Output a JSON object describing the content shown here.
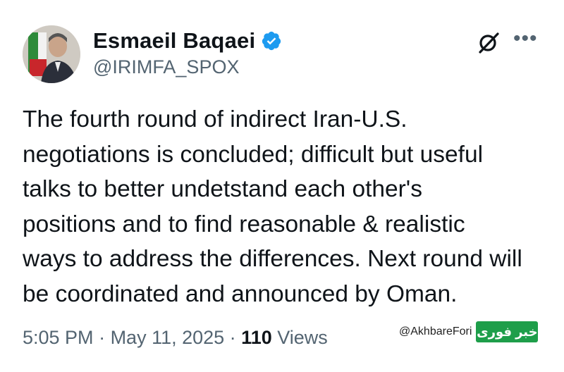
{
  "author": {
    "name": "Esmaeil Baqaei",
    "handle": "@IRIMFA_SPOX"
  },
  "post": {
    "lines": [
      "The fourth round of indirect Iran-U.S.",
      "negotiations is concluded; difficult but useful",
      "talks to better undetstand each other's",
      "positions and to find reasonable & realistic",
      "ways to address the differences. Next round will",
      "be coordinated and announced by Oman."
    ]
  },
  "meta": {
    "time": "5:05 PM",
    "separator": " · ",
    "date": "May 11, 2025",
    "views_count": "110",
    "views_label": " Views"
  },
  "watermark": {
    "handle": "@AkhbareFori",
    "logo_text": "خبر فوری"
  },
  "colors": {
    "verified_badge": "#1d9bf0",
    "secondary_text": "#536471",
    "watermark_green": "#1e9e4a"
  },
  "icons": [
    "verified-badge-icon",
    "grok-icon",
    "more-options-icon"
  ]
}
